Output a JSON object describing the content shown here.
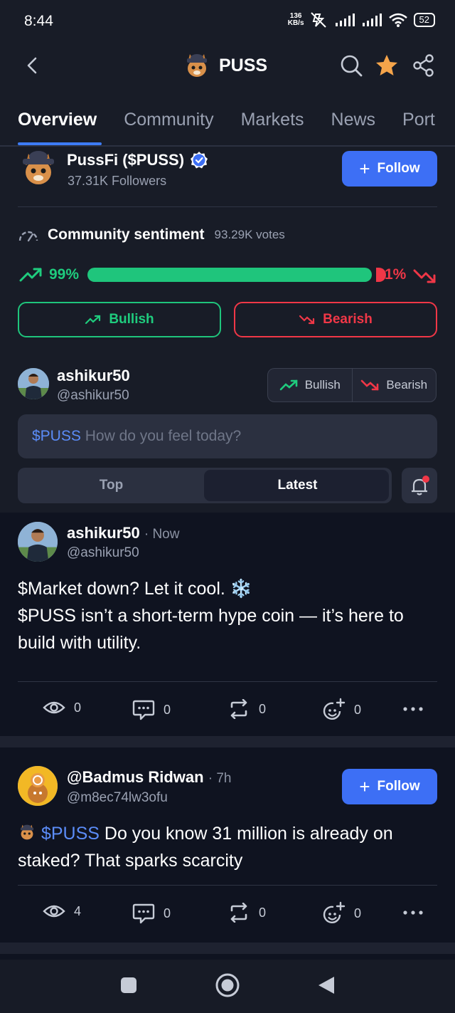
{
  "status_bar": {
    "time": "8:44",
    "net_speed_value": "136",
    "net_speed_unit": "KB/s",
    "battery": "52"
  },
  "header": {
    "title": "PUSS"
  },
  "tabs": [
    {
      "label": "Overview",
      "active": true
    },
    {
      "label": "Community",
      "active": false
    },
    {
      "label": "Markets",
      "active": false
    },
    {
      "label": "News",
      "active": false
    },
    {
      "label": "Port",
      "active": false
    }
  ],
  "profile": {
    "name": "PussFi ($PUSS)",
    "followers": "37.31K Followers",
    "follow_label": "Follow"
  },
  "sentiment": {
    "title": "Community sentiment",
    "votes": "93.29K votes",
    "bullish_pct_label": "99%",
    "bearish_pct_label": "1%",
    "bullish_fraction": 0.99,
    "bullish_label": "Bullish",
    "bearish_label": "Bearish"
  },
  "composer": {
    "username": "ashikur50",
    "handle": "@ashikur50",
    "toggle_bullish": "Bullish",
    "toggle_bearish": "Bearish",
    "ticker": "$PUSS",
    "placeholder": "How do you feel today?"
  },
  "feed_tabs": {
    "top": "Top",
    "latest": "Latest"
  },
  "posts": [
    {
      "username": "ashikur50",
      "time": "· Now",
      "handle": "@ashikur50",
      "line1": "$Market down? Let it cool. ❄️",
      "line2": "$PUSS isn’t a short-term hype coin — it’s here to",
      "line3": "build with utility.",
      "views": "0",
      "comments": "0",
      "reposts": "0",
      "reactions": "0"
    },
    {
      "username": "@Badmus Ridwan",
      "time": "· 7h",
      "handle": "@m8ec74lw3ofu",
      "follow_label": "Follow",
      "ticker": "$PUSS",
      "line1_rest": " Do you know 31 million is already on",
      "line2": "staked? That sparks scarcity",
      "views": "4",
      "comments": "0",
      "reposts": "0",
      "reactions": "0"
    }
  ],
  "colors": {
    "background": "#181c27",
    "feed_background": "#0f1320",
    "accent_blue": "#3d6ff5",
    "bullish_green": "#1fc57c",
    "bearish_red": "#f03747",
    "star_orange": "#f5a44a"
  },
  "icons": [
    "back-icon",
    "search-icon",
    "star-icon",
    "share-icon",
    "verified-icon",
    "gauge-icon",
    "trend-up-icon",
    "trend-down-icon",
    "bell-icon",
    "eye-icon",
    "comment-icon",
    "repost-icon",
    "react-icon",
    "more-icon"
  ]
}
